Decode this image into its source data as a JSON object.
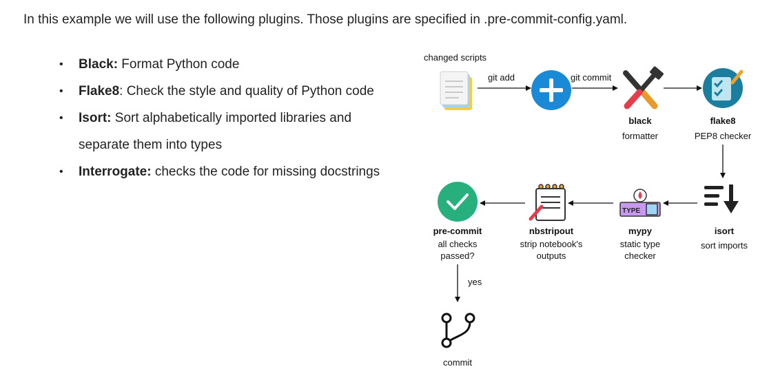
{
  "intro": "In this example we will use the following plugins. Those plugins are specified in .pre-commit-config.yaml.",
  "plugins": [
    {
      "name": "Black:",
      "desc": " Format Python code"
    },
    {
      "name": "Flake8",
      "desc": ": Check the style and quality of Python code"
    },
    {
      "name": "Isort:",
      "desc": " Sort alphabetically imported libraries and separate them into types"
    },
    {
      "name": "Interrogate:",
      "desc": " checks the code for missing docstrings"
    }
  ],
  "diagram": {
    "changed_scripts": "changed scripts",
    "git_add": "git add",
    "git_commit": "git commit",
    "black": {
      "title": "black",
      "sub": "formatter"
    },
    "flake8": {
      "title": "flake8",
      "sub": "PEP8 checker"
    },
    "isort": {
      "title": "isort",
      "sub": "sort imports"
    },
    "mypy": {
      "title": "mypy",
      "sub1": "static type",
      "sub2": "checker",
      "badge": "TYPE"
    },
    "nbstripout": {
      "title": "nbstripout",
      "sub1": "strip notebook's",
      "sub2": "outputs"
    },
    "precommit": {
      "title": "pre-commit",
      "sub1": "all checks",
      "sub2": "passed?"
    },
    "yes": "yes",
    "commit": "commit"
  },
  "colors": {
    "blue": "#1a8ad6",
    "green": "#27b07e",
    "teal": "#1b7e9e",
    "purple": "#c79af0",
    "red": "#e43d4c",
    "orange": "#f0a22a"
  }
}
